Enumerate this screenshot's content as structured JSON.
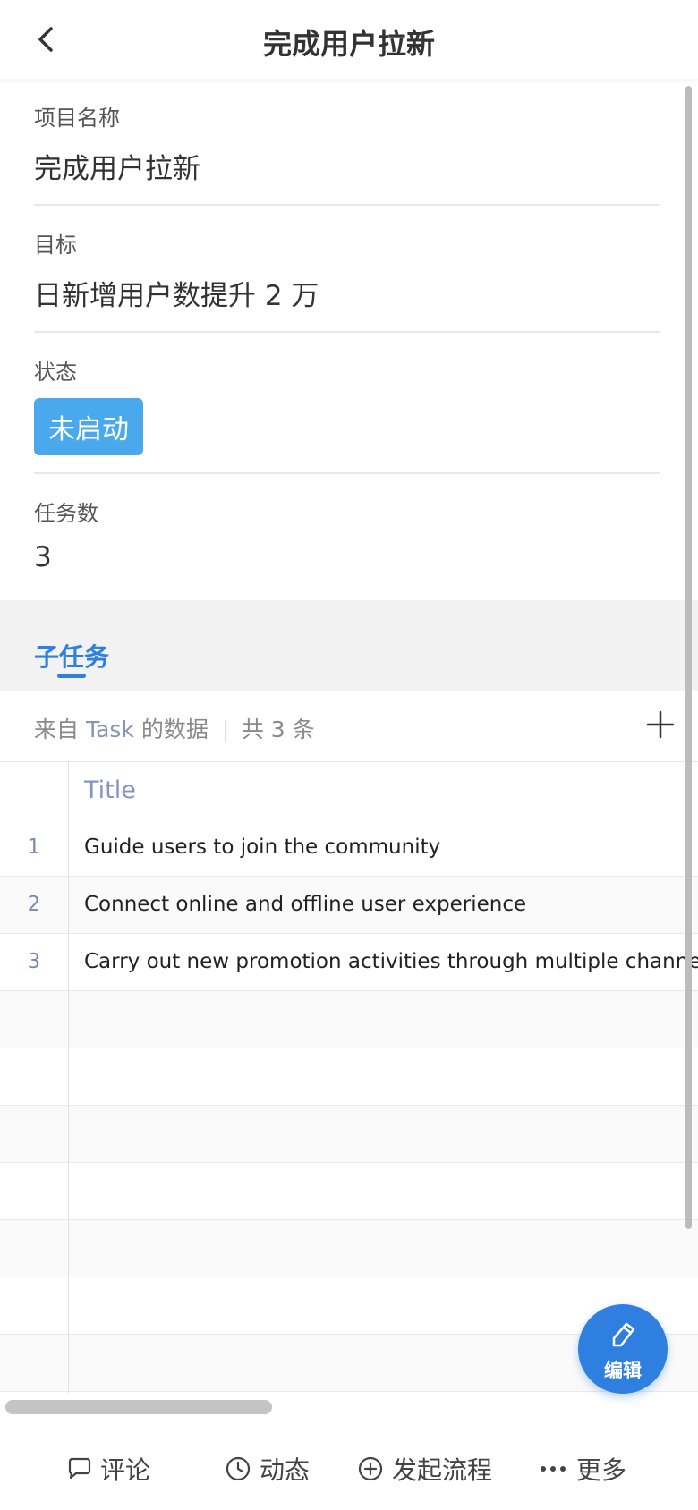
{
  "header": {
    "title": "完成用户拉新"
  },
  "fields": {
    "project_name": {
      "label": "项目名称",
      "value": "完成用户拉新"
    },
    "goal": {
      "label": "目标",
      "value": "日新增用户数提升 2 万"
    },
    "status": {
      "label": "状态",
      "value": "未启动",
      "color": "#4aa8ec"
    },
    "task_count": {
      "label": "任务数",
      "value": "3"
    }
  },
  "tabs": {
    "subtask": "子任务"
  },
  "source": {
    "prefix": "来自",
    "entity": "Task",
    "suffix": "的数据",
    "total": "共 3 条"
  },
  "table": {
    "column_title": "Title",
    "rows": [
      {
        "num": "1",
        "title": "Guide users to join the community"
      },
      {
        "num": "2",
        "title": "Connect online and offline user experience"
      },
      {
        "num": "3",
        "title": "Carry out new promotion activities through multiple channels"
      }
    ]
  },
  "fab": {
    "label": "编辑",
    "color": "#2f7fe0",
    "icon": "pencil-icon"
  },
  "bottom_bar": {
    "comment": {
      "label": "评论",
      "icon": "chat-bubble-icon"
    },
    "activity": {
      "label": "动态",
      "icon": "clock-icon"
    },
    "start_flow": {
      "label": "发起流程",
      "icon": "plus-circle-icon"
    },
    "more": {
      "label": "更多",
      "icon": "more-dots-icon"
    }
  }
}
